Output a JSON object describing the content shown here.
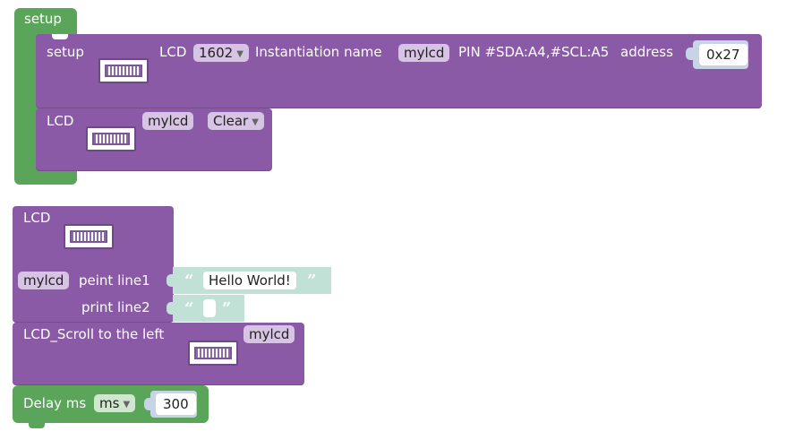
{
  "setup_block": {
    "label": "setup",
    "lcd_setup": {
      "label": "setup",
      "lcd_label": "LCD",
      "model": "1602",
      "inst_label": "Instantiation name",
      "name": "mylcd",
      "pin_label": "PIN #SDA:A4,#SCL:A5",
      "address_label": "address",
      "address": "0x27"
    },
    "lcd_clear": {
      "label": "LCD",
      "name": "mylcd",
      "action": "Clear"
    }
  },
  "print_block": {
    "label": "LCD",
    "name": "mylcd",
    "line1_label": "peint line1",
    "line1_value": "Hello World!",
    "line2_label": "print line2",
    "line2_value": ""
  },
  "scroll_block": {
    "label": "LCD_Scroll to the left",
    "name": "mylcd"
  },
  "delay_block": {
    "label": "Delay ms",
    "unit": "ms",
    "value": "300"
  },
  "colors": {
    "green": "#5ba55b",
    "purple": "#8b5aa6",
    "string": "#c1e0d6",
    "socket": "#c9d3e6"
  },
  "icons": [
    "lcd-display-icon",
    "dropdown-arrow-icon",
    "open-quote-icon",
    "close-quote-icon"
  ]
}
